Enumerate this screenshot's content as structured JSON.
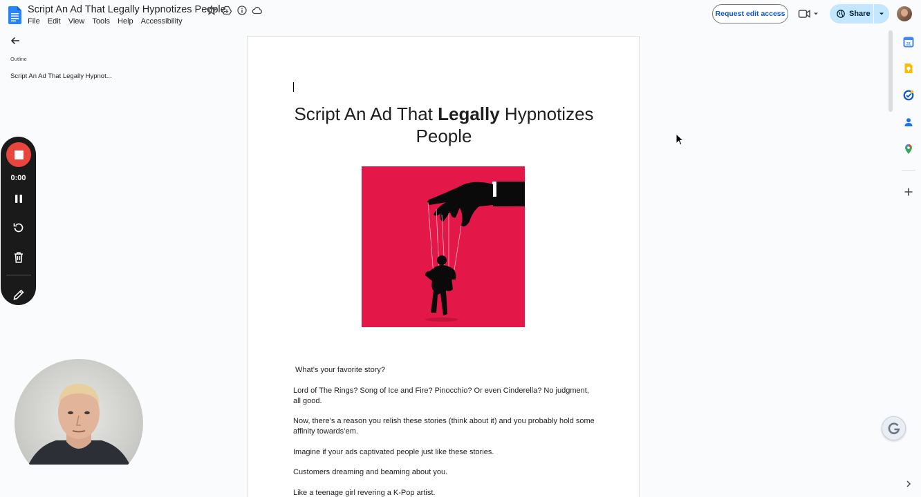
{
  "document": {
    "title": "Script An Ad That Legally Hypnotizes People"
  },
  "menu": [
    "File",
    "Edit",
    "View",
    "Tools",
    "Help",
    "Accessibility"
  ],
  "toolbar": {
    "request_edit_label": "Request edit access",
    "share_label": "Share"
  },
  "outline": {
    "label": "Outline",
    "items": [
      "Script An Ad That Legally Hypnot..."
    ]
  },
  "recorder": {
    "time": "0:00",
    "stop_color": "#e8453c"
  },
  "page": {
    "heading_part1": "Script An Ad That ",
    "heading_bold": "Legally",
    "heading_part2": " Hypnotizes People",
    "image_bg": "#e31849",
    "paragraphs": [
      "What’s your favorite story?",
      "Lord of The Rings? Song of Ice and Fire? Pinocchio? Or even Cinderella? No judgment, all good.",
      "Now, there’s a reason you relish these stories (think about it) and you probably hold some affinity towards’em.",
      "Imagine if your ads captivated people just like these stories.",
      "Customers dreaming and beaming about you.",
      "Like a teenage girl revering a K-Pop artist."
    ]
  },
  "colors": {
    "accent": "#0b57d0",
    "share_bg": "#c2e7ff",
    "background": "#f9fbfd"
  },
  "icons": [
    "docs-logo-icon",
    "star-icon",
    "move-to-drive-icon",
    "info-icon",
    "cloud-status-icon",
    "meet-video-icon",
    "globe-icon",
    "chevron-down-icon",
    "back-arrow-icon",
    "stop-icon",
    "pause-icon",
    "restart-icon",
    "trash-icon",
    "pencil-icon",
    "calendar-icon",
    "keep-icon",
    "tasks-icon",
    "contacts-icon",
    "maps-icon",
    "plus-icon",
    "chevron-right-icon",
    "grammarly-icon"
  ]
}
